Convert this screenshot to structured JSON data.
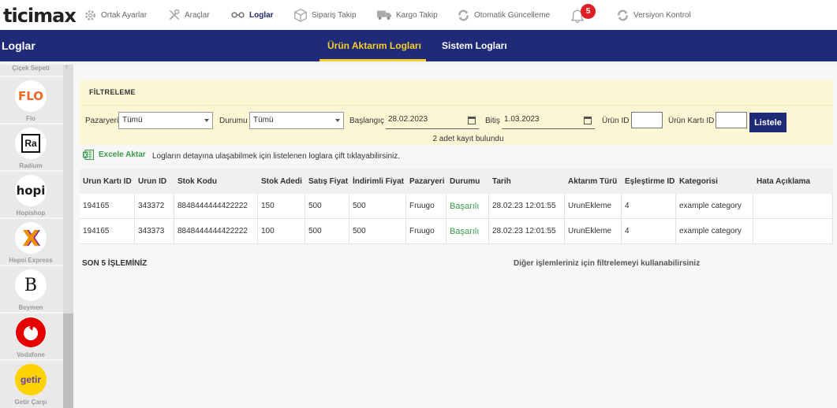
{
  "topbar": {
    "logo": "ticimax",
    "nav": [
      {
        "label": "Ortak Ayarlar",
        "icon": "gear-icon"
      },
      {
        "label": "Araçlar",
        "icon": "tools-icon"
      },
      {
        "label": "Loglar",
        "icon": "glasses-icon"
      },
      {
        "label": "Sipariş Takip",
        "icon": "box-icon"
      },
      {
        "label": "Kargo Takip",
        "icon": "truck-icon"
      },
      {
        "label": "Otomatik Güncelleme",
        "icon": "refresh-icon"
      },
      {
        "label": "Versiyon Kontrol",
        "icon": "refresh-icon"
      }
    ],
    "notification_count": "5"
  },
  "header": {
    "title": "Loglar",
    "tabs": [
      {
        "label": "Ürün Aktarım Logları",
        "active": true
      },
      {
        "label": "Sistem Logları",
        "active": false
      }
    ]
  },
  "sidebar": {
    "top_label": "Çiçek Sepeti",
    "items": [
      {
        "label": "Flo",
        "logo_text": "FLO"
      },
      {
        "label": "Radium",
        "logo_text": "Ra"
      },
      {
        "label": "Hopishop",
        "logo_text": "hopi"
      },
      {
        "label": "Hepsi Express",
        "logo_text": "X"
      },
      {
        "label": "Beymen",
        "logo_text": "B"
      },
      {
        "label": "Vodafone",
        "logo_text": ""
      },
      {
        "label": "Getir Çarşı",
        "logo_text": "getir"
      }
    ]
  },
  "filter": {
    "title": "FİLTRELEME",
    "pazaryeri_label": "Pazaryeri",
    "pazaryeri_value": "Tümü",
    "durumu_label": "Durumu",
    "durumu_value": "Tümü",
    "baslangic_label": "Başlangıç",
    "baslangic_value": "28.02.2023",
    "bitis_label": "Bitiş",
    "bitis_value": "1.03.2023",
    "urun_id_label": "Ürün ID",
    "urun_id_value": "",
    "urun_karti_id_label": "Ürün Kartı ID",
    "urun_karti_id_value": "",
    "button_label": "Listele",
    "result_count": "2 adet kayıt bulundu"
  },
  "actions": {
    "excel_label": "Excele Aktar",
    "hint": "Logların detayına ulaşabilmek için listelenen loglara çift tıklayabilirsiniz."
  },
  "table": {
    "columns": [
      "Urun Kartı ID",
      "Urun ID",
      "Stok Kodu",
      "Stok Adedi",
      "Satış Fiyat",
      "İndirimli Fiyat",
      "Pazaryeri",
      "Durumu",
      "Tarih",
      "Aktarım Türü",
      "Eşleştirme ID",
      "Kategorisi",
      "Hata Açıklama"
    ],
    "rows": [
      [
        "194165",
        "343372",
        "8848444444422222",
        "150",
        "500",
        "500",
        "Fruugo",
        "Başarılı",
        "28.02.23 12:01:55",
        "UrunEkleme",
        "4",
        "example category",
        ""
      ],
      [
        "194165",
        "343373",
        "8848444444422222",
        "100",
        "500",
        "500",
        "Fruugo",
        "Başarılı",
        "28.02.23 12:01:55",
        "UrunEkleme",
        "4",
        "example category",
        ""
      ]
    ]
  },
  "footer": {
    "son5": "SON 5 İŞLEMİNİZ",
    "diger": "Diğer işlemleriniz için filtrelemeyi kullanabilirsiniz"
  },
  "colors": {
    "brand_navy": "#1f2a78",
    "tab_active": "#f5cf2a",
    "success": "#3a9b4b",
    "badge": "#e01e26"
  }
}
